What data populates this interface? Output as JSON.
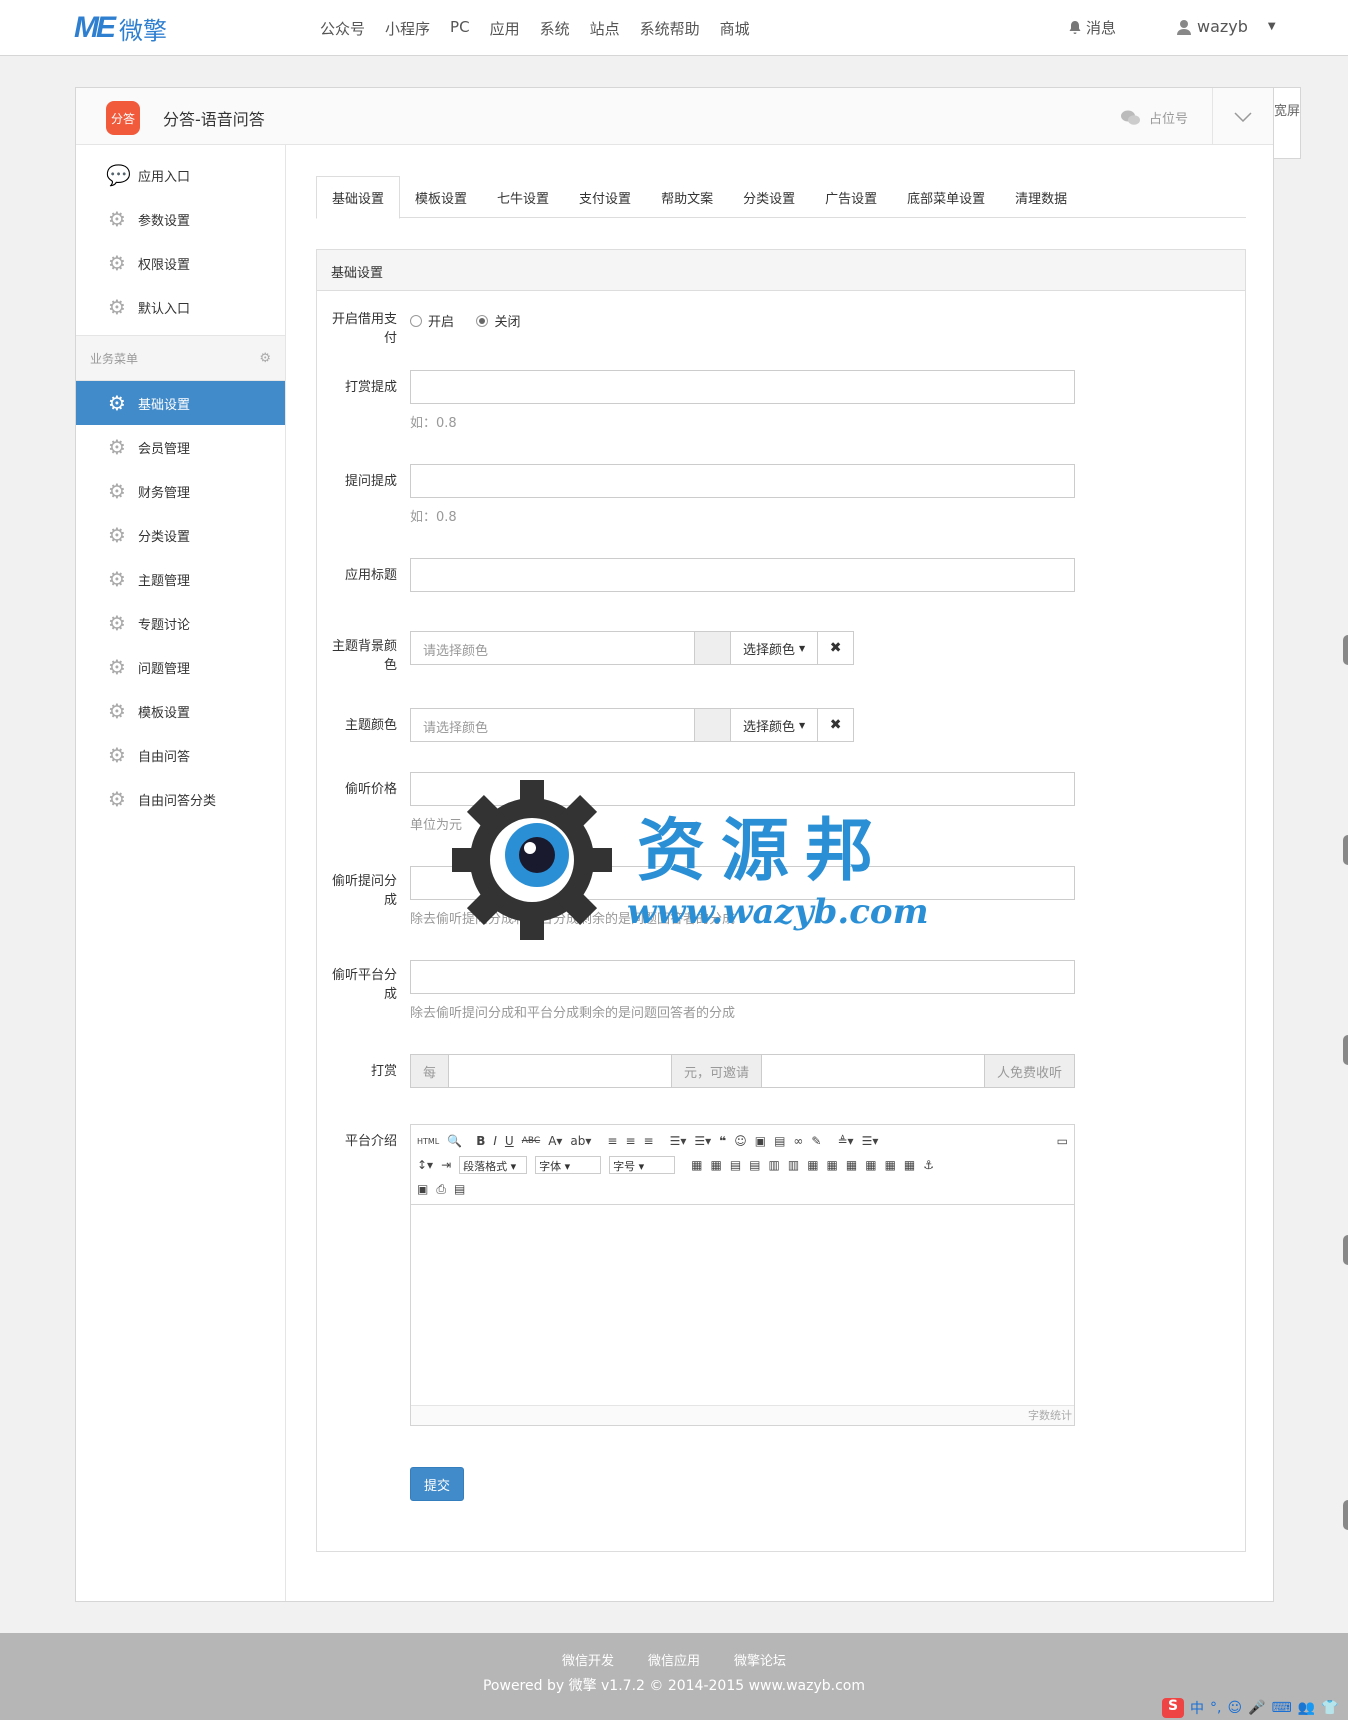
{
  "topbar": {
    "logo_me": "ME",
    "logo_cn": "微擎",
    "nav": [
      "公众号",
      "小程序",
      "PC",
      "应用",
      "系统",
      "站点",
      "系统帮助",
      "商城"
    ],
    "messages": "消息",
    "user": "wazyb"
  },
  "app": {
    "icon_text": "分答",
    "title": "分答-语音问答",
    "account": "占位号",
    "wide_screen": "宽屏"
  },
  "sidebar": {
    "top_items": [
      {
        "label": "应用入口",
        "icon": "comment-icon"
      },
      {
        "label": "参数设置",
        "icon": "gear-icon"
      },
      {
        "label": "权限设置",
        "icon": "gear-icon"
      },
      {
        "label": "默认入口",
        "icon": "gear-icon"
      }
    ],
    "group_title": "业务菜单",
    "items": [
      {
        "label": "基础设置",
        "active": true
      },
      {
        "label": "会员管理"
      },
      {
        "label": "财务管理"
      },
      {
        "label": "分类设置"
      },
      {
        "label": "主题管理"
      },
      {
        "label": "专题讨论"
      },
      {
        "label": "问题管理"
      },
      {
        "label": "模板设置"
      },
      {
        "label": "自由问答"
      },
      {
        "label": "自由问答分类"
      }
    ]
  },
  "tabs": [
    "基础设置",
    "模板设置",
    "七牛设置",
    "支付设置",
    "帮助文案",
    "分类设置",
    "广告设置",
    "底部菜单设置",
    "清理数据"
  ],
  "panel": {
    "title": "基础设置"
  },
  "form": {
    "credit_pay": {
      "label": "开启借用支付",
      "opt_on": "开启",
      "opt_off": "关闭",
      "selected": "关闭"
    },
    "reward_commission": {
      "label": "打赏提成",
      "value": "",
      "help": "如：0.8"
    },
    "question_commission": {
      "label": "提问提成",
      "value": "",
      "help": "如：0.8"
    },
    "app_title": {
      "label": "应用标题",
      "value": ""
    },
    "theme_bg_color": {
      "label": "主题背景颜色",
      "placeholder": "请选择颜色",
      "button": "选择颜色"
    },
    "theme_color": {
      "label": "主题颜色",
      "placeholder": "请选择颜色",
      "button": "选择颜色"
    },
    "listen_price": {
      "label": "偷听价格",
      "help": "单位为元"
    },
    "listen_question_share": {
      "label": "偷听提问分成",
      "help": "除去偷听提问分成和平台分成剩余的是问题回答者的分成"
    },
    "listen_platform_share": {
      "label": "偷听平台分成",
      "help": "除去偷听提问分成和平台分成剩余的是问题回答者的分成"
    },
    "reward": {
      "label": "打赏",
      "prefix": "每",
      "middle": "元，可邀请",
      "suffix": "人免费收听"
    },
    "intro": {
      "label": "平台介绍",
      "paragraph": "段落格式",
      "font": "字体",
      "size": "字号",
      "word_count": "字数统计"
    },
    "submit": "提交"
  },
  "watermark": {
    "title": "资源邦",
    "url": "www.wazyb.com"
  },
  "footer": {
    "links": [
      "微信开发",
      "微信应用",
      "微擎论坛"
    ],
    "powered": "Powered by 微擎 v1.7.2 © 2014-2015 www.wazyb.com"
  },
  "ime": {
    "logo": "S",
    "mode": "中"
  }
}
